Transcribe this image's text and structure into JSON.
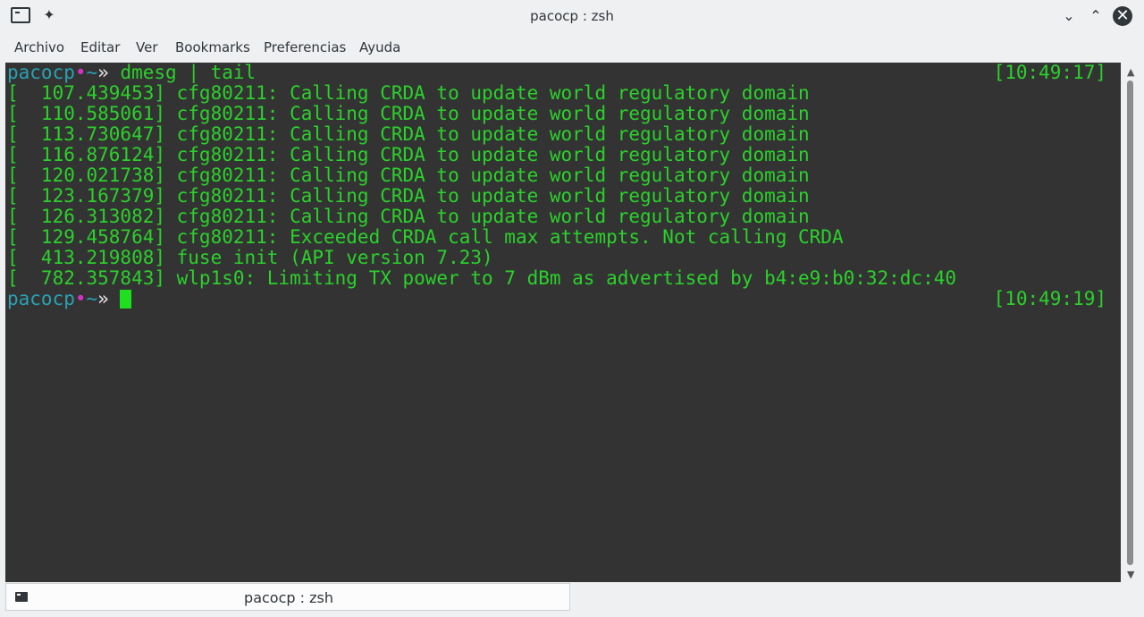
{
  "window": {
    "title": "pacocp : zsh",
    "buttons": {
      "minimize": "⌄",
      "maximize": "⌃",
      "close": "✕"
    }
  },
  "menu": [
    "Archivo",
    "Editar",
    "Ver",
    "Bookmarks",
    "Preferencias",
    "Ayuda"
  ],
  "prompt": {
    "user": "pacocp",
    "dot": "•",
    "dir": "~",
    "arrow": "»"
  },
  "terminal": {
    "command": "dmesg | tail",
    "command_time": "[10:49:17]",
    "output": [
      "[  107.439453] cfg80211: Calling CRDA to update world regulatory domain",
      "[  110.585061] cfg80211: Calling CRDA to update world regulatory domain",
      "[  113.730647] cfg80211: Calling CRDA to update world regulatory domain",
      "[  116.876124] cfg80211: Calling CRDA to update world regulatory domain",
      "[  120.021738] cfg80211: Calling CRDA to update world regulatory domain",
      "[  123.167379] cfg80211: Calling CRDA to update world regulatory domain",
      "[  126.313082] cfg80211: Calling CRDA to update world regulatory domain",
      "[  129.458764] cfg80211: Exceeded CRDA call max attempts. Not calling CRDA",
      "[  413.219808] fuse init (API version 7.23)",
      "[  782.357843] wlp1s0: Limiting TX power to 7 dBm as advertised by b4:e9:b0:32:dc:40"
    ],
    "prompt_time": "[10:49:19]"
  },
  "tab": {
    "label": "pacocp : zsh"
  },
  "colors": {
    "terminal_bg": "#333333",
    "output_green": "#2bd12b",
    "prompt_user": "#2aa1b3",
    "prompt_dot": "#d432c6"
  }
}
